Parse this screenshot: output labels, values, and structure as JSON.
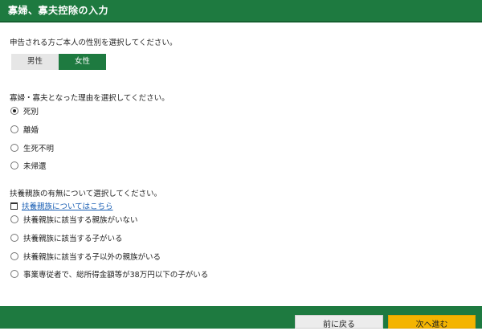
{
  "header": {
    "title": "寡婦、寡夫控除の入力"
  },
  "gender_section": {
    "question": "申告される方ご本人の性別を選択してください。",
    "options": [
      {
        "label": "男性",
        "selected": false
      },
      {
        "label": "女性",
        "selected": true
      }
    ]
  },
  "reason_section": {
    "question": "寡婦・寡夫となった理由を選択してください。",
    "options": [
      {
        "label": "死別",
        "checked": true
      },
      {
        "label": "離婚",
        "checked": false
      },
      {
        "label": "生死不明",
        "checked": false
      },
      {
        "label": "未帰還",
        "checked": false
      }
    ]
  },
  "dependent_section": {
    "question": "扶養親族の有無について選択してください。",
    "link_label": "扶養親族についてはこちら",
    "options": [
      {
        "label": "扶養親族に該当する親族がいない",
        "checked": false
      },
      {
        "label": "扶養親族に該当する子がいる",
        "checked": false
      },
      {
        "label": "扶養親族に該当する子以外の親族がいる",
        "checked": false
      },
      {
        "label": "事業専従者で、総所得金額等が38万円以下の子がいる",
        "checked": false
      }
    ]
  },
  "footer": {
    "back_label": "前に戻る",
    "next_label": "次へ進む"
  },
  "colors": {
    "brand_green": "#1e7a40",
    "next_button": "#f4b400",
    "link": "#1a5fb4"
  }
}
